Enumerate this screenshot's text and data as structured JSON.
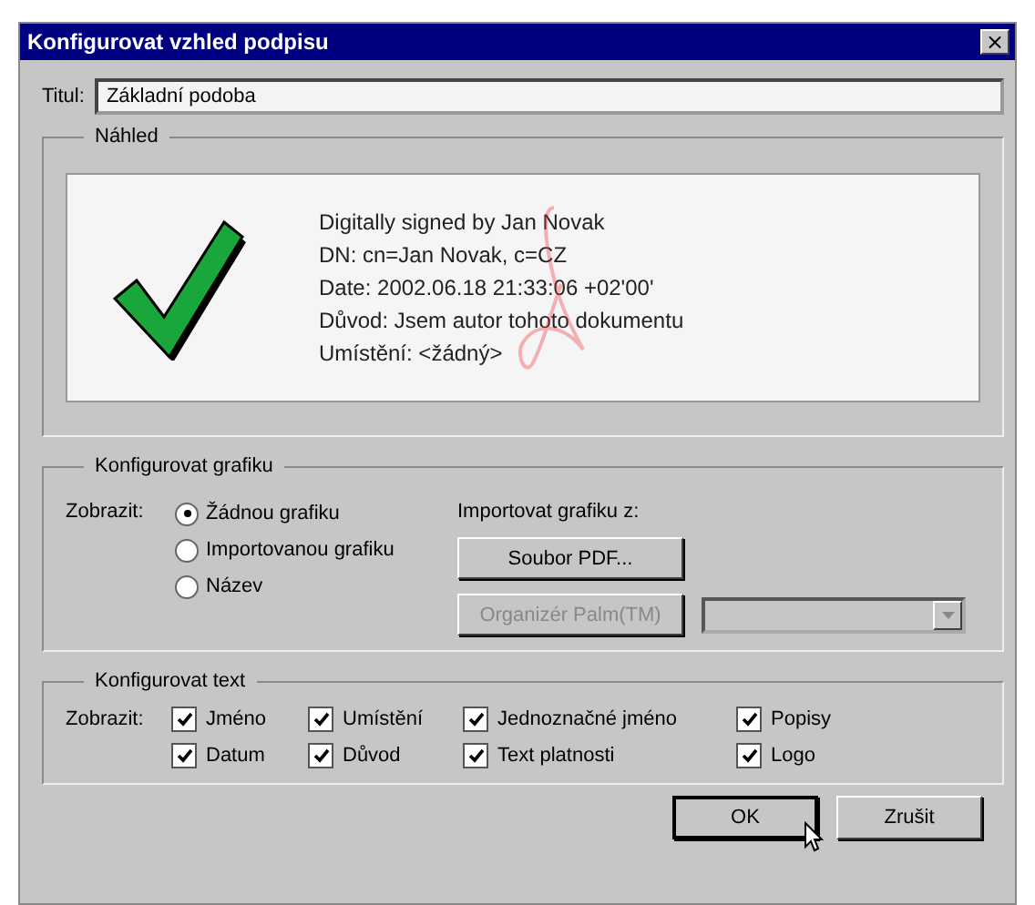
{
  "window": {
    "title": "Konfigurovat vzhled podpisu",
    "close": "×"
  },
  "title_field": {
    "label": "Titul:",
    "value": "Základní podoba"
  },
  "preview": {
    "legend": "Náhled",
    "lines": [
      "Digitally signed by Jan Novak",
      "DN: cn=Jan Novak, c=CZ",
      "Date: 2002.06.18 21:33:06 +02'00'",
      "Důvod: Jsem autor tohoto dokumentu",
      "Umístění: <žádný>"
    ]
  },
  "graphics": {
    "legend": "Konfigurovat grafiku",
    "show_label": "Zobrazit:",
    "options": [
      {
        "label": "Žádnou grafiku",
        "selected": true
      },
      {
        "label": "Importovanou grafiku",
        "selected": false
      },
      {
        "label": "Název",
        "selected": false
      }
    ],
    "import_label": "Importovat grafiku z:",
    "buttons": [
      {
        "label": "Soubor PDF...",
        "disabled": false
      },
      {
        "label": "Organizér Palm(TM)",
        "disabled": true
      }
    ],
    "dropdown": {
      "disabled": true
    }
  },
  "text": {
    "legend": "Konfigurovat text",
    "show_label": "Zobrazit:",
    "options": [
      {
        "label": "Jméno",
        "checked": true
      },
      {
        "label": "Umístění",
        "checked": true
      },
      {
        "label": "Jednoznačné jméno",
        "checked": true
      },
      {
        "label": "Popisy",
        "checked": true
      },
      {
        "label": "Datum",
        "checked": true
      },
      {
        "label": "Důvod",
        "checked": true
      },
      {
        "label": "Text platnosti",
        "checked": true
      },
      {
        "label": "Logo",
        "checked": true
      }
    ]
  },
  "buttons": [
    {
      "label": "OK",
      "default": true
    },
    {
      "label": "Zrušit",
      "default": false
    }
  ]
}
